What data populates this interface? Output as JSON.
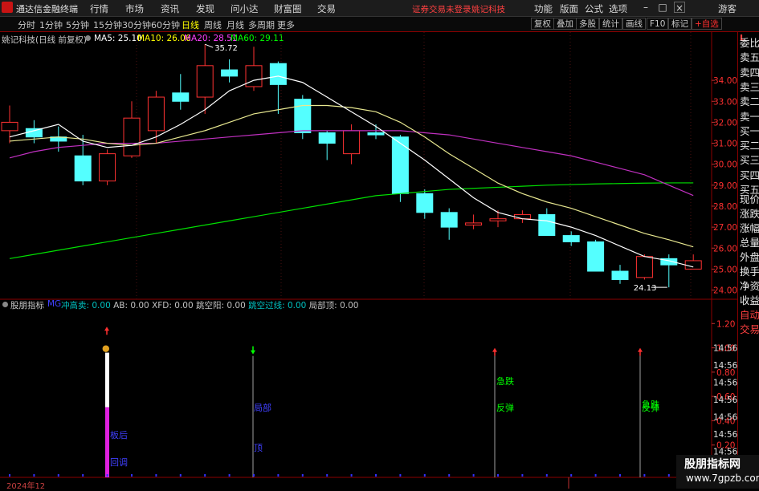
{
  "app": {
    "name": "通达信金融终端",
    "menu": [
      "行情",
      "市场",
      "资讯",
      "发现",
      "问小达",
      "财富圈",
      "交易"
    ],
    "notice": "证券交易未登录",
    "stock_name_top": "姚记科技",
    "right_menu": [
      "功能",
      "版面",
      "公式",
      "选项"
    ],
    "user": "游客"
  },
  "periods": [
    "分时",
    "1分钟",
    "5分钟",
    "15分钟",
    "30分钟",
    "60分钟",
    "日线",
    "周线",
    "月线",
    "多周期",
    "更多"
  ],
  "active_period": "日线",
  "tools": [
    "复权",
    "叠加",
    "多股",
    "统计",
    "画线",
    "F10",
    "标记",
    "+自选"
  ],
  "chart_header": {
    "title": "姚记科技(日线 前复权)",
    "ma": [
      {
        "label": "MA5: 25.10",
        "color": "#ffffff"
      },
      {
        "label": "MA10: 26.06",
        "color": "#ffff00"
      },
      {
        "label": "MA20: 28.51",
        "color": "#ff40ff"
      },
      {
        "label": "MA60: 29.11",
        "color": "#00ff00"
      }
    ]
  },
  "indicator_header": {
    "name": "股朋指标",
    "items": [
      {
        "label": "冲高卖: 0.00",
        "color": "#00c0c0"
      },
      {
        "label": "AB: 0.00",
        "color": "#c0c0c0"
      },
      {
        "label": "XFD: 0.00",
        "color": "#c0c0c0"
      },
      {
        "label": "跳空阳: 0.00",
        "color": "#c0c0c0"
      },
      {
        "label": "跳空过线: 0.00",
        "color": "#00c0c0"
      },
      {
        "label": "局部顶: 0.00",
        "color": "#c0c0c0"
      }
    ]
  },
  "indicator_labels": {
    "ban_hou": "板后",
    "hui_tiao": "回调",
    "ju_bu": "局部",
    "ji_die_1": "急跌",
    "fan_tan_1": "反弹",
    "ji_die_2": "急跌",
    "fan_tan_2": "反弹"
  },
  "date_label": "2024年12",
  "right_panel": [
    "委比",
    "卖五",
    "卖四",
    "卖三",
    "卖二",
    "卖一",
    "买一",
    "买二",
    "买三",
    "买四",
    "买五",
    "现价",
    "涨跌",
    "涨幅",
    "总量",
    "外盘",
    "换手",
    "净资",
    "收益",
    "自动",
    "交易"
  ],
  "watermark": {
    "line1": "股朋指标网",
    "line2": "www.7gpzb.com"
  },
  "chart_data": {
    "type": "candlestick",
    "y_ticks": [
      24.0,
      25.0,
      26.0,
      27.0,
      28.0,
      29.0,
      30.0,
      31.0,
      32.0,
      33.0,
      34.0
    ],
    "ylim": [
      23.6,
      36.3
    ],
    "high_label": "35.72",
    "low_label": "24.13",
    "candles": [
      {
        "o": 31.6,
        "c": 32.0,
        "h": 32.8,
        "l": 31.0
      },
      {
        "o": 31.7,
        "c": 31.3,
        "h": 32.1,
        "l": 31.0
      },
      {
        "o": 31.3,
        "c": 31.1,
        "h": 31.8,
        "l": 30.6
      },
      {
        "o": 30.4,
        "c": 29.2,
        "h": 31.4,
        "l": 29.0
      },
      {
        "o": 29.2,
        "c": 30.5,
        "h": 30.7,
        "l": 29.0
      },
      {
        "o": 30.4,
        "c": 32.2,
        "h": 33.0,
        "l": 30.3
      },
      {
        "o": 31.6,
        "c": 33.2,
        "h": 33.5,
        "l": 31.0
      },
      {
        "o": 33.4,
        "c": 33.0,
        "h": 34.3,
        "l": 32.6
      },
      {
        "o": 33.2,
        "c": 34.7,
        "h": 35.72,
        "l": 32.4
      },
      {
        "o": 34.5,
        "c": 34.2,
        "h": 35.0,
        "l": 33.9
      },
      {
        "o": 33.7,
        "c": 34.7,
        "h": 35.6,
        "l": 33.5
      },
      {
        "o": 34.8,
        "c": 33.8,
        "h": 34.9,
        "l": 32.4
      },
      {
        "o": 33.1,
        "c": 31.5,
        "h": 33.3,
        "l": 31.2
      },
      {
        "o": 31.5,
        "c": 31.0,
        "h": 31.6,
        "l": 30.2
      },
      {
        "o": 30.5,
        "c": 31.6,
        "h": 31.9,
        "l": 30.0
      },
      {
        "o": 31.5,
        "c": 31.4,
        "h": 31.9,
        "l": 31.2
      },
      {
        "o": 31.3,
        "c": 28.6,
        "h": 31.4,
        "l": 28.2
      },
      {
        "o": 28.6,
        "c": 27.7,
        "h": 28.8,
        "l": 27.4
      },
      {
        "o": 27.7,
        "c": 27.0,
        "h": 27.9,
        "l": 26.4
      },
      {
        "o": 27.1,
        "c": 27.2,
        "h": 27.6,
        "l": 26.9
      },
      {
        "o": 27.3,
        "c": 27.4,
        "h": 27.8,
        "l": 27.0
      },
      {
        "o": 27.4,
        "c": 27.6,
        "h": 27.8,
        "l": 27.2
      },
      {
        "o": 27.6,
        "c": 26.6,
        "h": 27.9,
        "l": 26.6
      },
      {
        "o": 26.6,
        "c": 26.3,
        "h": 26.8,
        "l": 26.1
      },
      {
        "o": 26.3,
        "c": 24.9,
        "h": 26.4,
        "l": 24.9
      },
      {
        "o": 24.9,
        "c": 24.5,
        "h": 25.2,
        "l": 24.3
      },
      {
        "o": 24.6,
        "c": 25.6,
        "h": 25.7,
        "l": 24.5
      },
      {
        "o": 25.5,
        "c": 25.2,
        "h": 25.7,
        "l": 24.13
      },
      {
        "o": 25.0,
        "c": 25.4,
        "h": 25.7,
        "l": 25.0
      }
    ],
    "ma5": [
      31.3,
      31.6,
      31.9,
      31.1,
      30.8,
      30.9,
      31.3,
      31.9,
      32.6,
      33.5,
      34.0,
      34.2,
      33.9,
      33.2,
      32.5,
      31.8,
      31.0,
      30.2,
      29.3,
      28.4,
      27.7,
      27.4,
      27.3,
      27.0,
      26.6,
      26.1,
      25.6,
      25.4,
      25.1
    ],
    "ma10": [
      31.1,
      31.2,
      31.3,
      31.2,
      31.0,
      30.9,
      31.0,
      31.3,
      31.6,
      32.0,
      32.4,
      32.6,
      32.8,
      32.8,
      32.7,
      32.5,
      32.0,
      31.3,
      30.5,
      29.8,
      29.1,
      28.6,
      28.2,
      27.9,
      27.5,
      27.1,
      26.7,
      26.4,
      26.06
    ],
    "ma20": [
      30.3,
      30.6,
      30.8,
      30.9,
      31.0,
      31.0,
      31.0,
      31.1,
      31.2,
      31.3,
      31.4,
      31.5,
      31.6,
      31.6,
      31.6,
      31.6,
      31.6,
      31.5,
      31.4,
      31.2,
      31.0,
      30.8,
      30.6,
      30.4,
      30.1,
      29.8,
      29.5,
      29.0,
      28.51
    ],
    "ma60": [
      25.5,
      25.7,
      25.9,
      26.1,
      26.3,
      26.5,
      26.7,
      26.9,
      27.1,
      27.3,
      27.5,
      27.7,
      27.9,
      28.1,
      28.3,
      28.5,
      28.6,
      28.7,
      28.8,
      28.85,
      28.9,
      28.95,
      29.0,
      29.03,
      29.06,
      29.08,
      29.1,
      29.11,
      29.11
    ],
    "indicator_y_ticks": [
      0.2,
      0.4,
      0.6,
      0.8,
      1.0,
      1.2
    ],
    "time_ticks": [
      "14:56",
      "14:56",
      "14:56",
      "14:56",
      "14:56",
      "14:56",
      "14:56"
    ]
  }
}
